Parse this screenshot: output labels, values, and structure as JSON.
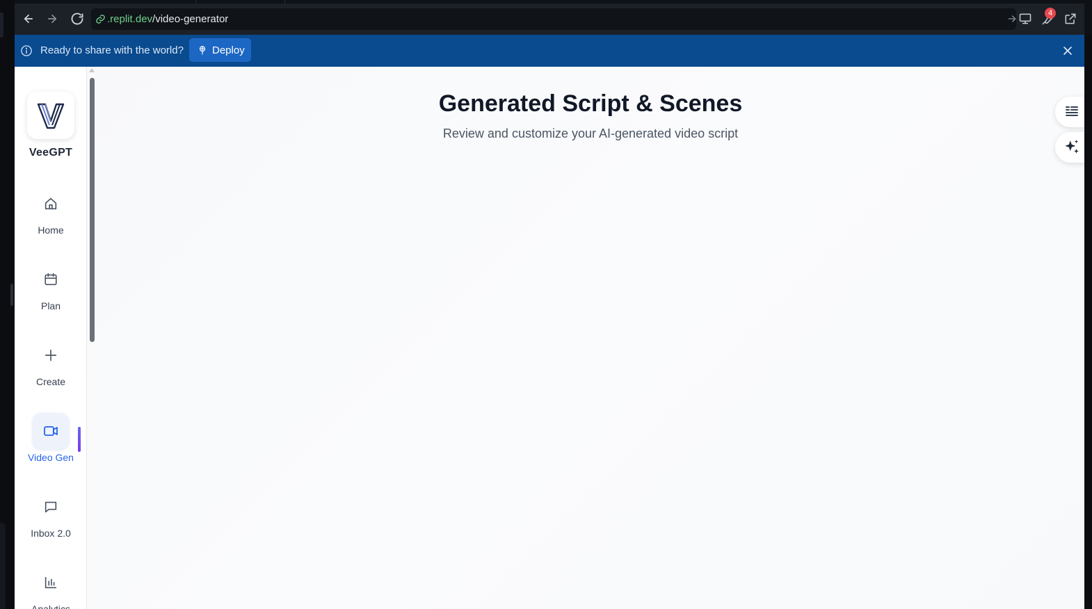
{
  "browser": {
    "url_domain": ".replit.dev",
    "url_path": "/video-generator",
    "notification_count": "4"
  },
  "banner": {
    "message": "Ready to share with the world?",
    "deploy_label": "Deploy"
  },
  "sidebar": {
    "brand": "VeeGPT",
    "items": [
      {
        "label": "Home",
        "icon": "home-icon"
      },
      {
        "label": "Plan",
        "icon": "calendar-icon"
      },
      {
        "label": "Create",
        "icon": "plus-icon"
      },
      {
        "label": "Video Gen",
        "icon": "video-camera-icon",
        "active": true
      },
      {
        "label": "Inbox 2.0",
        "icon": "chat-bubble-icon"
      },
      {
        "label": "Analytics",
        "icon": "bar-chart-icon"
      }
    ]
  },
  "main": {
    "title": "Generated Script & Scenes",
    "subtitle": "Review and customize your AI-generated video script"
  },
  "colors": {
    "banner": "#0a4a8f",
    "deploy_button": "#1d67c4",
    "active_nav": "#2563eb",
    "badge": "#e5484d"
  }
}
